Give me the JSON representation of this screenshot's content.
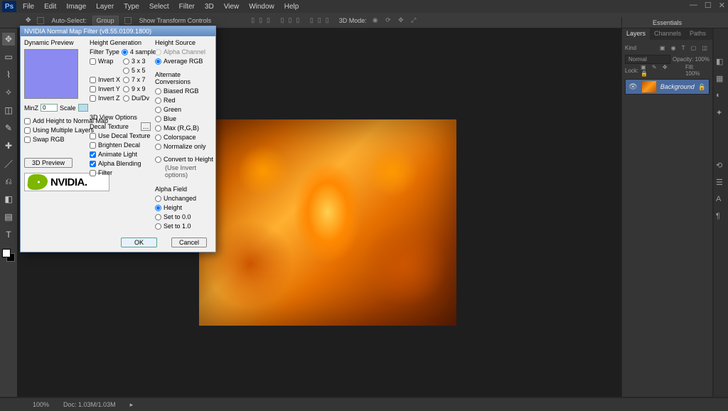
{
  "menubar": [
    "File",
    "Edit",
    "Image",
    "Layer",
    "Type",
    "Select",
    "Filter",
    "3D",
    "View",
    "Window",
    "Help"
  ],
  "optionbar": {
    "auto_select": "Auto-Select:",
    "group": "Group",
    "show_tc": "Show Transform Controls",
    "mode_3d": "3D Mode:"
  },
  "essentials": "Essentials",
  "panel_tabs": [
    "Layers",
    "Channels",
    "Paths"
  ],
  "layer_kind": "Kind",
  "layer_mode": "Normal",
  "layer_opacity": "Opacity: 100%",
  "layer_lock": "Lock:",
  "layer_fill": "Fill: 100%",
  "bg_layer": "Background",
  "status_zoom": "100%",
  "status_doc": "Doc: 1.03M/1.03M",
  "dialog": {
    "title": "NVIDIA Normal Map Filter (v8.55.0109.1800)",
    "dynamic_preview": "Dynamic Preview",
    "add_height": "Add Height to Normal Map",
    "using_ml": "Using Multiple Layers",
    "swap_rgb": "Swap RGB",
    "preview_3d": "3D Preview",
    "nvidia": "NVIDIA.",
    "hg": {
      "header": "Height Generation",
      "filter_type": "Filter Type",
      "four_sample": "4 sample",
      "wrap": "Wrap",
      "r3x3": "3 x 3",
      "r5x5": "5 x 5",
      "invert_x": "Invert X",
      "r7x7": "7 x 7",
      "invert_y": "Invert Y",
      "r9x9": "9 x 9",
      "invert_z": "Invert Z",
      "dudv": "Du/Dv",
      "minz": "MinZ",
      "minz_val": "0",
      "scale": "Scale"
    },
    "dv": {
      "header": "3D View Options",
      "decal": "Decal Texture",
      "use_decal": "Use Decal Texture",
      "brighten": "Brighten Decal",
      "animate": "Animate Light",
      "alpha_blend": "Alpha Blending",
      "filter": "Filter"
    },
    "hs": {
      "header": "Height Source",
      "alpha": "Alpha Channel",
      "avg": "Average RGB"
    },
    "ac": {
      "header": "Alternate Conversions",
      "biased": "Biased RGB",
      "red": "Red",
      "green": "Green",
      "blue": "Blue",
      "max": "Max (R,G,B)",
      "colorspace": "Colorspace",
      "normalize": "Normalize only",
      "convert": "Convert to Height",
      "use_invert": "(Use Invert options)"
    },
    "af": {
      "header": "Alpha Field",
      "unchanged": "Unchanged",
      "height": "Height",
      "set0": "Set to 0.0",
      "set1": "Set to 1.0"
    },
    "ok": "OK",
    "cancel": "Cancel"
  }
}
